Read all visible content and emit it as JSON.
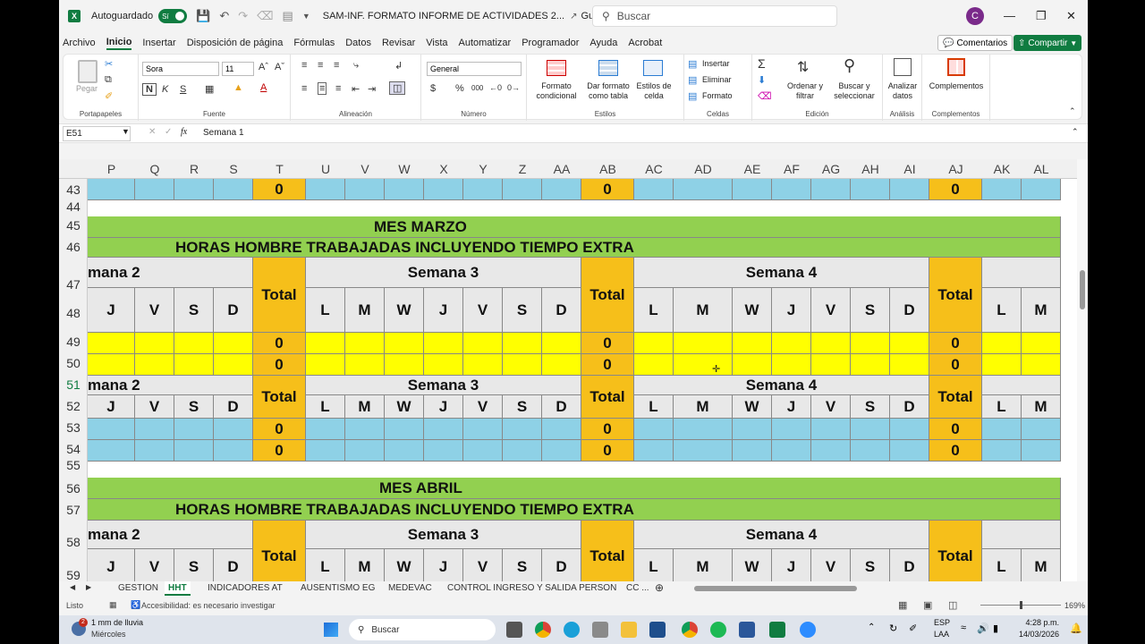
{
  "titlebar": {
    "autosave_label": "Autoguardado",
    "toggle_state": "Sí",
    "filename": "SAM-INF. FORMATO INFORME DE ACTIVIDADES 2...",
    "saved_label": "Guardado",
    "search_placeholder": "Buscar",
    "user_initial": "C"
  },
  "menu": [
    "Archivo",
    "Inicio",
    "Insertar",
    "Disposición de página",
    "Fórmulas",
    "Datos",
    "Revisar",
    "Vista",
    "Automatizar",
    "Programador",
    "Ayuda",
    "Acrobat"
  ],
  "menu_active": "Inicio",
  "menu_right": {
    "comments": "Comentarios",
    "share": "Compartir"
  },
  "ribbon": {
    "clipboard": {
      "paste": "Pegar",
      "label": "Portapapeles"
    },
    "font": {
      "name": "Sora",
      "size": "11",
      "bold": "N",
      "italic": "K",
      "underline": "S",
      "label": "Fuente"
    },
    "alignment": {
      "label": "Alineación"
    },
    "number": {
      "format": "General",
      "label": "Número",
      "currency": "$",
      "percent": "%",
      "thousands": "000"
    },
    "styles": {
      "conditional": "Formato condicional",
      "table": "Dar formato como tabla",
      "cell": "Estilos de celda",
      "label": "Estilos"
    },
    "cells": {
      "insert": "Insertar",
      "delete": "Eliminar",
      "format": "Formato",
      "label": "Celdas"
    },
    "editing": {
      "sort": "Ordenar y filtrar",
      "find": "Buscar y seleccionar",
      "label": "Edición"
    },
    "analysis": {
      "analyze": "Analizar datos",
      "label": "Análisis"
    },
    "addins": {
      "addins": "Complementos",
      "label": "Complementos"
    }
  },
  "formula_bar": {
    "namebox": "E51",
    "content": "Semana 1",
    "fx": "fx"
  },
  "columns": [
    "P",
    "Q",
    "R",
    "S",
    "T",
    "U",
    "V",
    "W",
    "X",
    "Y",
    "Z",
    "AA",
    "AB",
    "AC",
    "AD",
    "AE",
    "AF",
    "AG",
    "AH",
    "AI",
    "AJ",
    "AK",
    "AL"
  ],
  "rows": [
    "43",
    "44",
    "45",
    "46",
    "47",
    "48",
    "49",
    "50",
    "51",
    "52",
    "53",
    "54",
    "55",
    "56",
    "57",
    "58",
    "59"
  ],
  "sheet": {
    "month1": "MES MARZO",
    "month2": "MES ABRIL",
    "hours_title": "HORAS HOMBRE TRABAJADAS INCLUYENDO TIEMPO EXTRA",
    "week2_partial": "mana 2",
    "week3": "Semana 3",
    "week4": "Semana 4",
    "total": "Total",
    "zero": "0",
    "days_week2": [
      "J",
      "V",
      "S",
      "D"
    ],
    "days_full": [
      "L",
      "M",
      "W",
      "J",
      "V",
      "S",
      "D"
    ],
    "days_after": [
      "L",
      "M"
    ]
  },
  "tabs": [
    "GESTION",
    "HHT",
    "INDICADORES AT",
    "AUSENTISMO EG",
    "MEDEVAC",
    "CONTROL INGRESO Y SALIDA PERSON",
    "CC ..."
  ],
  "tab_active": "HHT",
  "status": {
    "ready": "Listo",
    "accessibility": "Accesibilidad: es necesario investigar",
    "zoom": "169%"
  },
  "taskbar": {
    "weather_title": "1 mm de lluvia",
    "weather_sub": "Miércoles",
    "weather_badge": "2",
    "search": "Buscar",
    "lang1": "ESP",
    "lang2": "LAA",
    "time": "4:28 p.m.",
    "date": "14/03/2026"
  },
  "colors": {
    "excel_green": "#107c41",
    "sheet_green": "#92d050",
    "cell_blue": "#8ed1e6",
    "total_orange": "#f6bf1a",
    "yellow": "#ffff00",
    "header_gray": "#e8e8e8"
  }
}
